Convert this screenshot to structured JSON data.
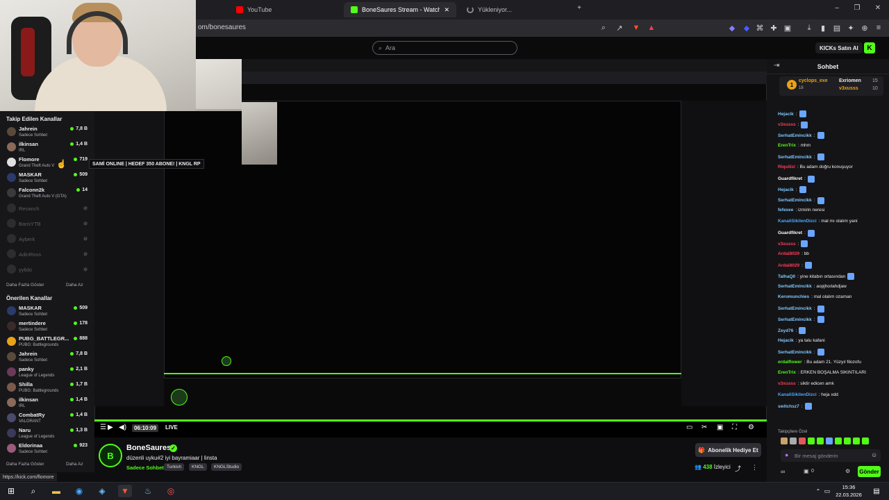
{
  "browser": {
    "tabs": [
      {
        "label": "YouTube",
        "favicon_color": "#ff0000"
      },
      {
        "label": "BoneSaures Stream - Watch Live",
        "favicon_color": "#53fc18"
      },
      {
        "label": "Yükleniyor...",
        "favicon_color": "#888888"
      }
    ],
    "address": "om/bonesaures",
    "new_tab": "+",
    "window_controls": [
      "–",
      "❐",
      "✕"
    ]
  },
  "kick_header": {
    "search_placeholder": "Ara",
    "buy_ai_label": "KICKs Satın Al",
    "logo_letter": "K"
  },
  "sidebar": {
    "followed_heading": "Takip Edilen Kanallar",
    "followed": [
      {
        "name": "Jahrein",
        "sub": "Sadece Sohbet",
        "viewers": "7,8 B",
        "color": "#5a4a3a",
        "live": true
      },
      {
        "name": "ilkinsan",
        "sub": "IRL",
        "viewers": "1,4 B",
        "color": "#8a6a5a",
        "live": true
      },
      {
        "name": "Flomore",
        "sub": "Grand Theft Auto V",
        "viewers": "719",
        "color": "#e0e0e0",
        "live": true
      },
      {
        "name": "MASKAR",
        "sub": "Sadece Sohbet",
        "viewers": "509",
        "color": "#2a3a6a",
        "live": true
      },
      {
        "name": "Falconn2k",
        "sub": "Grand Theft Auto V (GTA)",
        "viewers": "14",
        "color": "#3a3a3a",
        "live": true
      },
      {
        "name": "Revanch",
        "sub": "",
        "viewers": "⊘",
        "color": "#555555",
        "live": false
      },
      {
        "name": "BarisYTB",
        "sub": "",
        "viewers": "⊘",
        "color": "#555555",
        "live": false
      },
      {
        "name": "Ayberk",
        "sub": "",
        "viewers": "⊘",
        "color": "#555555",
        "live": false
      },
      {
        "name": "AdinRoss",
        "sub": "",
        "viewers": "⊘",
        "color": "#555555",
        "live": false
      },
      {
        "name": "yylido",
        "sub": "",
        "viewers": "⊘",
        "color": "#555555",
        "live": false
      }
    ],
    "show_more": "Daha Fazla Göster",
    "show_less": "Daha Az",
    "recommended_heading": "Önerilen Kanallar",
    "recommended": [
      {
        "name": "MASKAR",
        "sub": "Sadece Sohbet",
        "viewers": "509",
        "color": "#2a3a6a"
      },
      {
        "name": "mertindere",
        "sub": "Sadece Sohbet",
        "viewers": "178",
        "color": "#3a2a2a"
      },
      {
        "name": "PUBG_BATTLEGR...",
        "sub": "PUBG: Battlegrounds",
        "viewers": "888",
        "color": "#e8a317"
      },
      {
        "name": "Jahrein",
        "sub": "Sadece Sohbet",
        "viewers": "7,8 B",
        "color": "#5a4a3a"
      },
      {
        "name": "panky",
        "sub": "League of Legends",
        "viewers": "2,1 B",
        "color": "#6a3a5a"
      },
      {
        "name": "Shilla",
        "sub": "PUBG: Battlegrounds",
        "viewers": "1,7 B",
        "color": "#7a5a4a"
      },
      {
        "name": "ilkinsan",
        "sub": "IRL",
        "viewers": "1,4 B",
        "color": "#8a6a5a"
      },
      {
        "name": "CombatRy",
        "sub": "VALORANT",
        "viewers": "1,4 B",
        "color": "#4a4a6a"
      },
      {
        "name": "Naru",
        "sub": "League of Legends",
        "viewers": "1,3 B",
        "color": "#3a3a5a"
      },
      {
        "name": "Eldorinaa",
        "sub": "Sadece Sohbet",
        "viewers": "923",
        "color": "#9a5a7a"
      }
    ],
    "show_more_2": "Daha Fazla Göster",
    "show_less_2": "Daha Az",
    "tooltip": "SAMİ ONLINE | HEDEF 350 ABONE! | KNGL RP"
  },
  "player": {
    "time": "06:10:09",
    "live_label": "LIVE"
  },
  "stream": {
    "logo_text": "B",
    "streamer": "BoneSaures",
    "title": "düzenli uyku#2  iyi bayramiaar |  linsta",
    "category": "Sadece Sohbet",
    "tags": [
      "Turkish",
      "KNGL",
      "KNGLStudio"
    ],
    "gift_button": "Abonelik Hediye Et",
    "viewers_count": "438",
    "viewers_label": "İzleyici"
  },
  "chat": {
    "header": "Sohbet",
    "pinned": [
      {
        "user": "cyclops_exe",
        "count": "18",
        "user2": "Exriomen",
        "count2": "15"
      },
      {
        "user": "",
        "count": "",
        "user2": "v3xusss",
        "count2": "10"
      }
    ],
    "messages": [
      {
        "user": "Hejacik",
        "color": "#7ec8ff",
        "text": ":",
        "emote": true
      },
      {
        "user": "v3xusss",
        "color": "#ff3c5a",
        "text": ":",
        "emote": true
      },
      {
        "user": "SerhatEmincikk",
        "color": "#7ec8ff",
        "text": ":",
        "emote": true
      },
      {
        "user": "ErenTrix",
        "color": "#53fc18",
        "text": ": mhm",
        "emote": false
      },
      {
        "user": "SerhatEmincikk",
        "color": "#7ec8ff",
        "text": ":",
        "emote": true
      },
      {
        "user": "Riquilizi",
        "color": "#ff3c5a",
        "text": ": Bu adam doğru konuşuyor",
        "emote": false
      },
      {
        "user": "Guardfikret",
        "color": "#ffffff",
        "text": ":",
        "emote": true
      },
      {
        "user": "Hejacik",
        "color": "#7ec8ff",
        "text": ":",
        "emote": true
      },
      {
        "user": "SerhatEmincikk",
        "color": "#7ec8ff",
        "text": ":",
        "emote": true
      },
      {
        "user": "fefexee",
        "color": "#7ec8ff",
        "text": ": izmirin neresi",
        "emote": false
      },
      {
        "user": "KanaliSikilenDizci",
        "color": "#4ea6ff",
        "text": ": mal mı olalım yani",
        "emote": false
      },
      {
        "user": "Guardfikret",
        "color": "#ffffff",
        "text": ":",
        "emote": true
      },
      {
        "user": "v3xusss",
        "color": "#ff3c5a",
        "text": ":",
        "emote": true
      },
      {
        "user": "Ardai8029",
        "color": "#ff3c5a",
        "text": ": bb",
        "emote": false
      },
      {
        "user": "Ardai8029",
        "color": "#ff3c5a",
        "text": ":",
        "emote": true
      },
      {
        "user": "TalhaQ0",
        "color": "#7ec8ff",
        "text": ": yine kitabın ortasından",
        "emote": true
      },
      {
        "user": "SerhatEmincikk",
        "color": "#7ec8ff",
        "text": ": aopjhoılahdjaw",
        "emote": false
      },
      {
        "user": "Keromunchies",
        "color": "#7ec8ff",
        "text": ": mal olalım ozaman",
        "emote": false
      },
      {
        "user": "SerhatEmincikk",
        "color": "#7ec8ff",
        "text": ":",
        "emote": true
      },
      {
        "user": "SerhatEmincikk",
        "color": "#7ec8ff",
        "text": ":",
        "emote": true
      },
      {
        "user": "Zeyd76",
        "color": "#7ec8ff",
        "text": ":",
        "emote": true
      },
      {
        "user": "Hejacik",
        "color": "#7ec8ff",
        "text": ": ya talu kafani",
        "emote": false
      },
      {
        "user": "SerhatEmincikk",
        "color": "#7ec8ff",
        "text": ":",
        "emote": true
      },
      {
        "user": "erdalflower",
        "color": "#53fc18",
        "text": ": Bu adam 21. Yüzyıl filozofu",
        "emote": false
      },
      {
        "user": "ErenTrix",
        "color": "#53fc18",
        "text": ": ERKEN BOŞALMA SIKINTILARI",
        "emote": false
      },
      {
        "user": "v3xusss",
        "color": "#ff3c5a",
        "text": ": siktir edicen amk",
        "emote": false
      },
      {
        "user": "KanaliSikilenDizci",
        "color": "#4ea6ff",
        "text": ": heja xdd",
        "emote": false
      },
      {
        "user": "switchsz7",
        "color": "#7ec8ff",
        "text": ":",
        "emote": true
      }
    ],
    "followers_label": "Takipçilere Özel",
    "input_placeholder": "Bir mesaj gönderin",
    "send_label": "Gönder",
    "kicks_count": "0"
  },
  "status_url": "https://kick.com/flomore",
  "taskbar": {
    "time": "15:36",
    "date": "22.03.2026"
  }
}
